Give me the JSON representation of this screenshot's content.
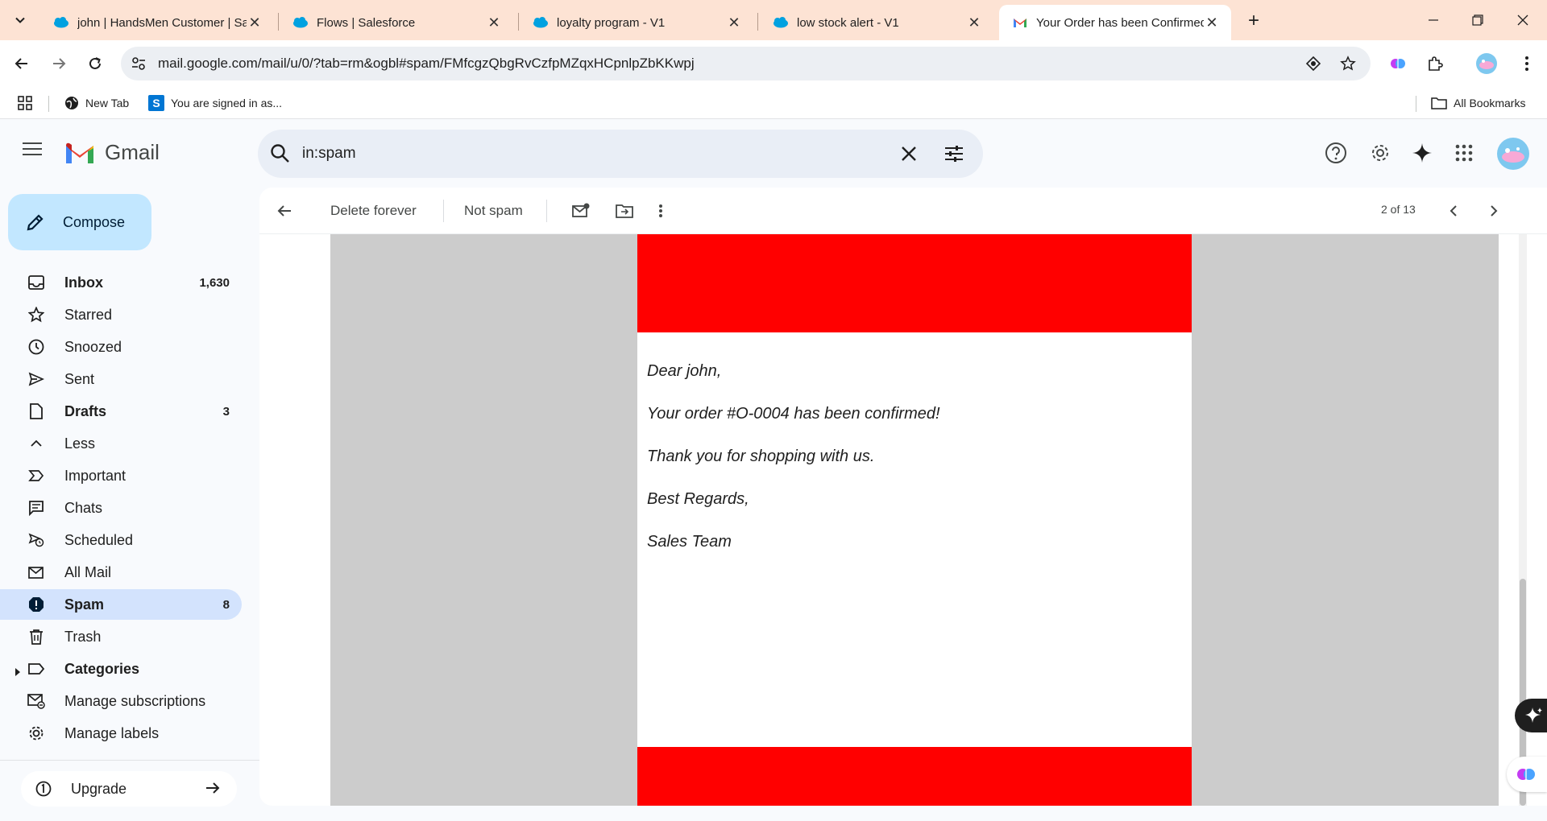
{
  "browser": {
    "tabs": [
      {
        "title": "john | HandsMen Customer | Sa",
        "favicon": "salesforce-icon",
        "active": false
      },
      {
        "title": "Flows | Salesforce",
        "favicon": "salesforce-icon",
        "active": false
      },
      {
        "title": "loyalty program - V1",
        "favicon": "salesforce-icon",
        "active": false
      },
      {
        "title": "low stock alert - V1",
        "favicon": "salesforce-icon",
        "active": false
      },
      {
        "title": "Your Order has been Confirmed",
        "favicon": "gmail-icon",
        "active": true
      }
    ],
    "url": "mail.google.com/mail/u/0/?tab=rm&ogbl#spam/FMfcgzQbgRvCzfpMZqxHCpnlpZbKKwpj",
    "bookmarks": [
      {
        "label": "New Tab",
        "icon": "globe-icon"
      },
      {
        "label": "You are signed in as...",
        "icon": "salesforce-s-icon"
      }
    ],
    "all_bookmarks_label": "All Bookmarks"
  },
  "gmail": {
    "logo_text": "Gmail",
    "search_query": "in:spam",
    "compose_label": "Compose",
    "nav": [
      {
        "label": "Inbox",
        "count": "1,630",
        "icon": "inbox-icon",
        "bold": true
      },
      {
        "label": "Starred",
        "count": "",
        "icon": "star-icon",
        "bold": false
      },
      {
        "label": "Snoozed",
        "count": "",
        "icon": "clock-icon",
        "bold": false
      },
      {
        "label": "Sent",
        "count": "",
        "icon": "send-icon",
        "bold": false
      },
      {
        "label": "Drafts",
        "count": "3",
        "icon": "draft-icon",
        "bold": true
      },
      {
        "label": "Less",
        "count": "",
        "icon": "chevron-up-icon",
        "bold": false
      },
      {
        "label": "Important",
        "count": "",
        "icon": "important-icon",
        "bold": false
      },
      {
        "label": "Chats",
        "count": "",
        "icon": "chat-icon",
        "bold": false
      },
      {
        "label": "Scheduled",
        "count": "",
        "icon": "scheduled-icon",
        "bold": false
      },
      {
        "label": "All Mail",
        "count": "",
        "icon": "all-mail-icon",
        "bold": false
      },
      {
        "label": "Spam",
        "count": "8",
        "icon": "spam-icon",
        "bold": true,
        "active": true
      },
      {
        "label": "Trash",
        "count": "",
        "icon": "trash-icon",
        "bold": false
      },
      {
        "label": "Categories",
        "count": "",
        "icon": "label-icon",
        "bold": true
      },
      {
        "label": "Manage subscriptions",
        "count": "",
        "icon": "subscriptions-icon",
        "bold": false
      },
      {
        "label": "Manage labels",
        "count": "",
        "icon": "gear-icon",
        "bold": false
      }
    ],
    "upgrade_label": "Upgrade",
    "actions": {
      "delete_forever": "Delete forever",
      "not_spam": "Not spam",
      "pager": "2 of 13"
    },
    "email": {
      "lines": [
        "Dear john,",
        "Your order #O-0004 has been confirmed!",
        "Thank you for shopping with us.",
        "Best Regards,",
        "Sales Team"
      ],
      "banner_color": "#ff0000"
    }
  }
}
